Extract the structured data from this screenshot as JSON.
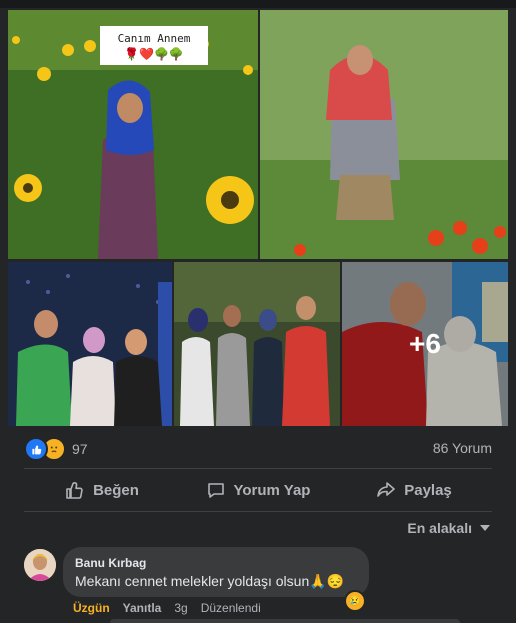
{
  "post": {
    "caption_title": "Canım Annem",
    "caption_emoji": "🌹❤️🌳🌳",
    "more_photos": "+6"
  },
  "stats": {
    "reaction_count": "97",
    "comment_count": "86 Yorum",
    "reaction_icons": [
      "like-icon",
      "sad-icon"
    ]
  },
  "actions": {
    "like_label": "Beğen",
    "comment_label": "Yorum Yap",
    "share_label": "Paylaş"
  },
  "sort": {
    "label": "En alakalı"
  },
  "comment": {
    "author": "Banu Kırbag",
    "text": "Mekanı cennet melekler yoldaşı olsun🙏😔",
    "reaction_emoji": "😢",
    "reacted_label": "Üzgün",
    "reply_label": "Yanıtla",
    "time": "3g",
    "edited_label": "Düzenlendi"
  },
  "colors": {
    "background": "#242526",
    "bubble": "#3a3b3c",
    "text_primary": "#e4e6eb",
    "text_secondary": "#b0b3b8",
    "like_blue": "#2078f4",
    "sad_yellow": "#f7b125"
  }
}
